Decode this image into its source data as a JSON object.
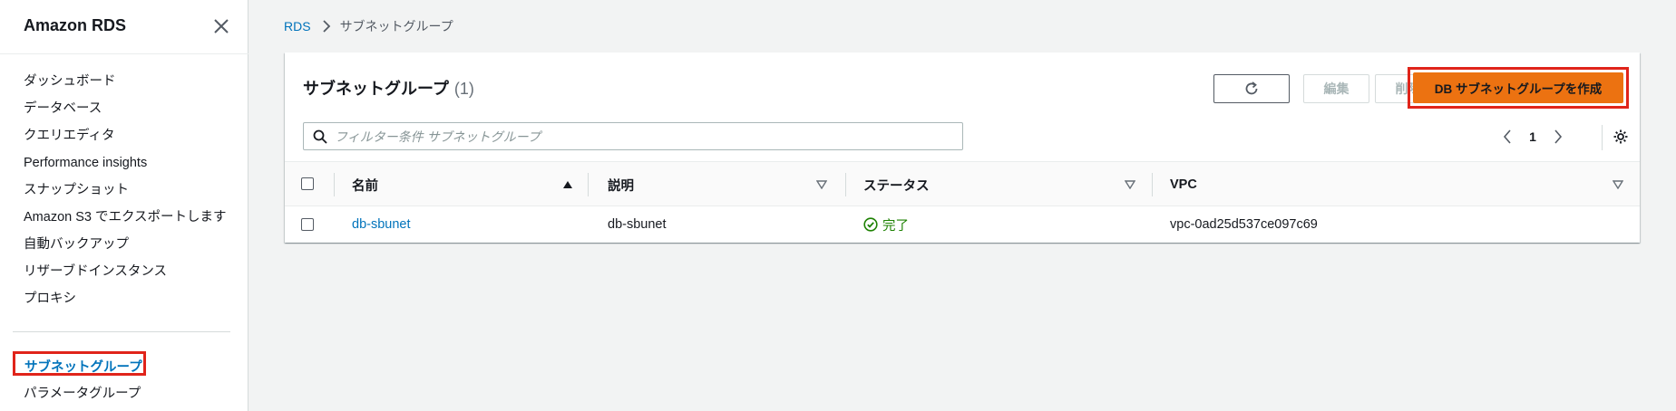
{
  "sidebar": {
    "title": "Amazon RDS",
    "items": [
      {
        "label": "ダッシュボード"
      },
      {
        "label": "データベース"
      },
      {
        "label": "クエリエディタ"
      },
      {
        "label": "Performance insights"
      },
      {
        "label": "スナップショット"
      },
      {
        "label": "Amazon S3 でエクスポートします"
      },
      {
        "label": "自動バックアップ"
      },
      {
        "label": "リザーブドインスタンス"
      },
      {
        "label": "プロキシ"
      }
    ],
    "active_item": "サブネットグループ",
    "after_item": "パラメータグループ"
  },
  "breadcrumb": {
    "root": "RDS",
    "current": "サブネットグループ"
  },
  "panel": {
    "title": "サブネットグループ",
    "count": "(1)",
    "edit_label": "編集",
    "delete_label": "削除",
    "create_label": "DB サブネットグループを作成",
    "search_placeholder": "フィルター条件 サブネットグループ",
    "page_number": "1"
  },
  "table": {
    "columns": [
      "名前",
      "説明",
      "ステータス",
      "VPC"
    ],
    "rows": [
      {
        "name": "db-sbunet",
        "description": "db-sbunet",
        "status": "完了",
        "vpc": "vpc-0ad25d537ce097c69"
      }
    ]
  },
  "colors": {
    "accent": "#ec7211",
    "link": "#0073bb",
    "success": "#1d8102",
    "highlight": "#e0241a"
  }
}
